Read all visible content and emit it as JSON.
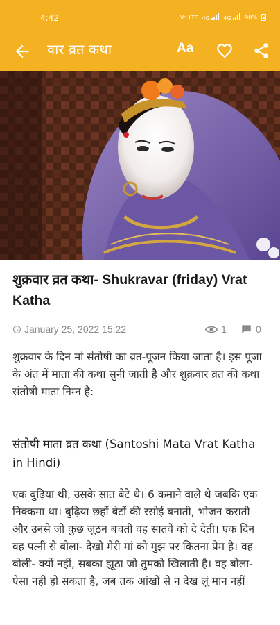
{
  "status_bar": {
    "time": "4:42",
    "network": "Vo LTE",
    "signal1": "4G",
    "signal2": "4G",
    "battery": "90%"
  },
  "app_bar": {
    "title": "वार व्रत कथा",
    "font_button": "Aa",
    "icons": [
      "arrow-back-icon",
      "favorite-heart-icon",
      "share-icon"
    ],
    "background": "#f4b223"
  },
  "article": {
    "title": "शुक्रवार व्रत कथा- Shukravar (friday) Vrat Katha",
    "date": "January 25, 2022 15:22",
    "views": "1",
    "comments": "0",
    "intro": "शुक्रवार के दिन मां संतोषी का व्रत-पूजन किया जाता है। इस पूजा के अंत में माता की कथा सुनी जाती है और शुक्रवार व्रत की कथा संतोषी माता निम्न है:",
    "subheading": "संतोषी माता व्रत कथा (Santoshi Mata Vrat Katha in Hindi)",
    "story": "एक बुढ़िया थी, उसके सात बेटे थे। 6 कमाने वाले थे जबकि एक निक्कमा था। बुढ़िया छहों बेटों की रसोई बनाती, भोजन कराती और उनसे जो कुछ जूठन बचती वह सातवें को दे देती। एक दिन वह पत्नी से बोला- देखो मेरी मां को मुझ पर कितना प्रेम है। वह बोली- क्यों नहीं, सबका झूठा जो तुमको खिलाती है। वह बोला- ऐसा नहीं हो सकता है, जब तक आंखों से न देख लूं मान नहीं"
  }
}
